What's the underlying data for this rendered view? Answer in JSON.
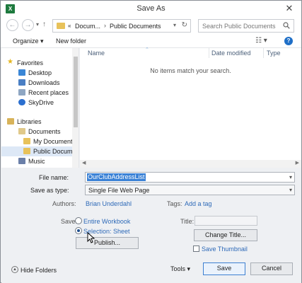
{
  "window": {
    "title": "Save As",
    "app_icon": "excel-icon"
  },
  "nav": {
    "back_icon": "back-arrow-icon",
    "forward_icon": "forward-arrow-icon",
    "up_icon": "up-arrow-icon",
    "breadcrumb": [
      "«",
      "Docum...",
      "Public Documents"
    ],
    "search_placeholder": "Search Public Documents"
  },
  "toolbar": {
    "organize": "Organize ▾",
    "new_folder": "New folder"
  },
  "sidebar": {
    "items": [
      {
        "label": "Favorites",
        "icon": "star-icon"
      },
      {
        "label": "Desktop",
        "icon": "desktop-icon"
      },
      {
        "label": "Downloads",
        "icon": "downloads-icon"
      },
      {
        "label": "Recent places",
        "icon": "recent-places-icon"
      },
      {
        "label": "SkyDrive",
        "icon": "cloud-icon"
      },
      {
        "label": "Libraries",
        "icon": "libraries-icon"
      },
      {
        "label": "Documents",
        "icon": "documents-icon"
      },
      {
        "label": "My Documents",
        "icon": "folder-icon"
      },
      {
        "label": "Public Docume",
        "icon": "folder-icon"
      },
      {
        "label": "Music",
        "icon": "music-icon"
      }
    ]
  },
  "content": {
    "columns": [
      "Name",
      "Date modified",
      "Type"
    ],
    "empty_message": "No items match your search."
  },
  "form": {
    "file_name_label": "File name:",
    "file_name_value": "OurClubAddressList",
    "save_type_label": "Save as type:",
    "save_type_value": "Single File Web Page",
    "authors_label": "Authors:",
    "authors_value": "Brian Underdahl",
    "tags_label": "Tags:",
    "tags_value": "Add a tag",
    "save_label": "Save:",
    "radio_workbook": "Entire Workbook",
    "radio_selection": "Selection: Sheet",
    "title_label": "Title:",
    "publish": "Publish...",
    "change_title": "Change Title...",
    "save_thumbnail": "Save Thumbnail"
  },
  "footer": {
    "hide_folders": "Hide Folders",
    "tools": "Tools",
    "save": "Save",
    "cancel": "Cancel"
  }
}
